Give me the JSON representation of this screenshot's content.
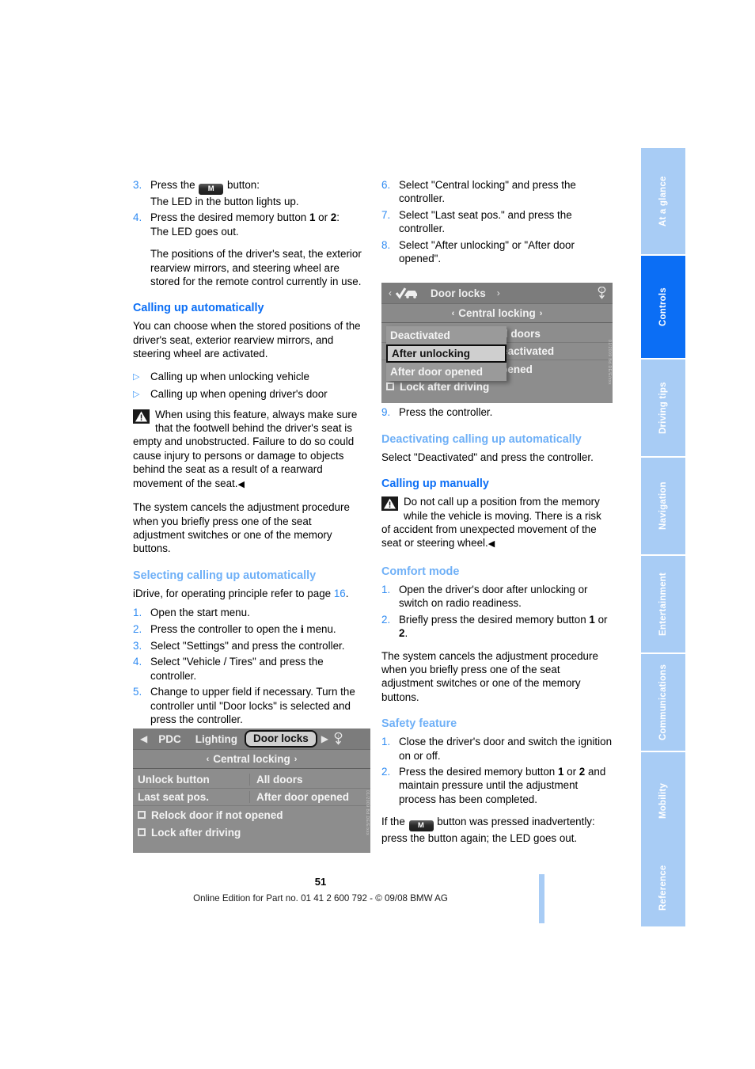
{
  "sidebar": {
    "tabs": [
      {
        "label": "At a glance",
        "active": false
      },
      {
        "label": "Controls",
        "active": true
      },
      {
        "label": "Driving tips",
        "active": false
      },
      {
        "label": "Navigation",
        "active": false
      },
      {
        "label": "Entertainment",
        "active": false
      },
      {
        "label": "Communications",
        "active": false
      },
      {
        "label": "Mobility",
        "active": false
      },
      {
        "label": "Reference",
        "active": false
      }
    ],
    "active_color": "#0b6ef5",
    "inactive_color": "#a8ccf5"
  },
  "left_column": {
    "steps_top": [
      {
        "num": "3.",
        "line1_a": "Press the ",
        "button": "M",
        "line1_b": " button:",
        "line2": "The LED in the button lights up."
      },
      {
        "num": "4.",
        "line1_a": "Press the desired memory button ",
        "b1": "1",
        "mid": " or ",
        "b2": "2",
        "line1_b": ":",
        "line2": "The LED goes out."
      }
    ],
    "para_stored": "The positions of the driver's seat, the exterior rearview mirrors, and steering wheel are stored for the remote control currently in use.",
    "heading_calling_auto": "Calling up automatically",
    "para_choose": "You can choose when the stored positions of the driver's seat, exterior rearview mirrors, and steering wheel are activated.",
    "bullets": [
      "Calling up when unlocking vehicle",
      "Calling up when opening driver's door"
    ],
    "warning": "When using this feature, always make sure that the footwell behind the driver's seat is empty and unobstructed. Failure to do so could cause injury to persons or damage to objects behind the seat as a result of a rearward movement of the seat.",
    "para_cancels": "The system cancels the adjustment procedure when you briefly press one of the seat adjustment switches or one of the memory buttons.",
    "heading_selecting": "Selecting calling up automatically",
    "idrive_ref_a": "iDrive, for operating principle refer to page ",
    "idrive_ref_page": "16",
    "idrive_ref_b": ".",
    "steps": [
      {
        "num": "1.",
        "text": "Open the start menu."
      },
      {
        "num": "2.",
        "text_a": "Press the controller to open the ",
        "glyph": "i",
        "text_b": " menu."
      },
      {
        "num": "3.",
        "text": "Select \"Settings\" and press the controller."
      },
      {
        "num": "4.",
        "text": "Select \"Vehicle / Tires\" and press the controller."
      },
      {
        "num": "5.",
        "text": "Change to upper field if necessary. Turn the controller until \"Door locks\" is selected and press the controller."
      }
    ]
  },
  "right_column": {
    "steps": [
      {
        "num": "6.",
        "text": "Select \"Central locking\" and press the controller."
      },
      {
        "num": "7.",
        "text": "Select \"Last seat pos.\" and press the controller."
      },
      {
        "num": "8.",
        "text": "Select \"After unlocking\" or \"After door opened\"."
      }
    ],
    "step9": {
      "num": "9.",
      "text": "Press the controller."
    },
    "heading_deactivating": "Deactivating calling up automatically",
    "para_deactivated": "Select \"Deactivated\" and press the controller.",
    "heading_manually": "Calling up manually",
    "warning": "Do not call up a position from the memory while the vehicle is moving. There is a risk of accident from unexpected movement of the seat or steering wheel.",
    "heading_comfort": "Comfort mode",
    "comfort_steps": [
      {
        "num": "1.",
        "text": "Open the driver's door after unlocking or switch on radio readiness."
      },
      {
        "num": "2.",
        "text_a": "Briefly press the desired memory button ",
        "b1": "1",
        "mid": " or ",
        "b2": "2",
        "text_b": "."
      }
    ],
    "para_cancels": "The system cancels the adjustment procedure when you briefly press one of the seat adjustment switches or one of the memory buttons.",
    "heading_safety": "Safety feature",
    "safety_steps": [
      {
        "num": "1.",
        "text": "Close the driver's door and switch the ignition on or off."
      },
      {
        "num": "2.",
        "text_a": "Press the desired memory button ",
        "b1": "1",
        "mid": " or ",
        "b2": "2",
        "text_b": " and maintain pressure until the adjustment process has been completed."
      }
    ],
    "para_inadvertent_a": "If the ",
    "para_inadvertent_button": "M",
    "para_inadvertent_b": " button was pressed inadvertently: press the button again; the LED goes out."
  },
  "idrive_left": {
    "topbar": {
      "left_arrow": "◀",
      "items": [
        "PDC",
        "Lighting"
      ],
      "selected": "Door locks",
      "right_arrow": "▶",
      "lock_icon": "central-lock-icon"
    },
    "subbar": "Central locking",
    "subbar_left_arrow": "‹",
    "subbar_right_arrow": "›",
    "rows": [
      {
        "label": "Unlock button",
        "value": "All doors"
      },
      {
        "label": "Last seat pos.",
        "value": "After door opened"
      }
    ],
    "checkboxes": [
      "Relock door if not opened",
      "Lock after driving"
    ],
    "sidecode": "01/2009 Bd.DE/E/xxx"
  },
  "idrive_right": {
    "topbar": {
      "left_arrow": "‹",
      "title": "Door locks",
      "right_arrow": "›",
      "check_vehicle_icon": "check-vehicle-icon",
      "lock_icon": "central-lock-icon"
    },
    "subbar": "Central locking",
    "subbar_left_arrow": "‹",
    "subbar_right_arrow": "›",
    "popup_items": [
      {
        "label": "Deactivated",
        "selected": false
      },
      {
        "label": "After unlocking",
        "selected": true
      },
      {
        "label": "After door opened",
        "selected": false
      }
    ],
    "background_rows": [
      "ll doors",
      "eactivated",
      "pened"
    ],
    "checkbox_row": "Lock after driving",
    "sidecode": "01/2009 Bd.DE/E/xxx"
  },
  "footer": {
    "page_number": "51",
    "text": "Online Edition for Part no. 01 41 2 600 792 - © 09/08 BMW AG"
  }
}
